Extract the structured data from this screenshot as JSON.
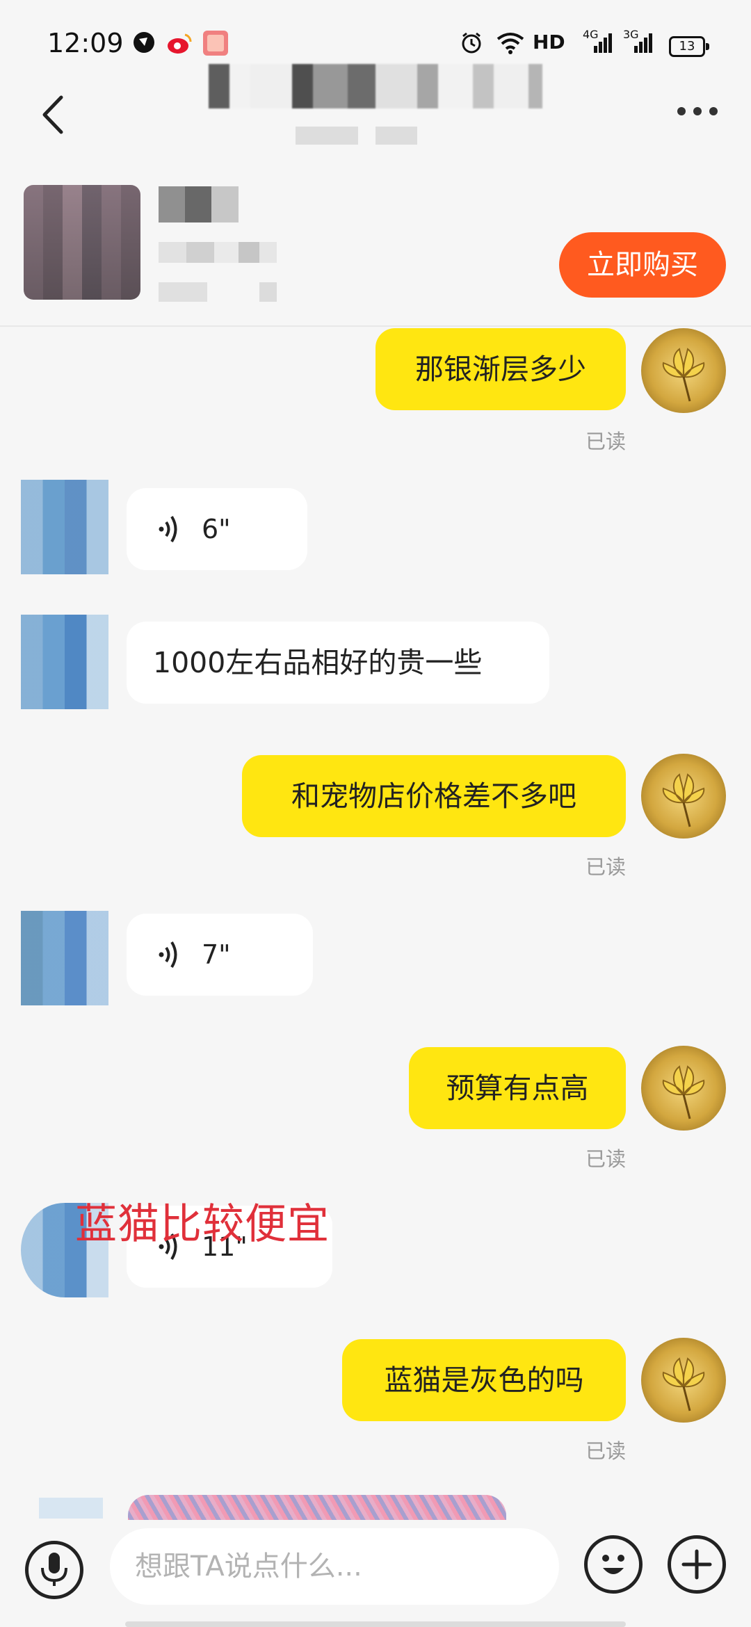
{
  "status_bar": {
    "time": "12:09",
    "network": "HD",
    "signal1": "4G",
    "signal2": "3G",
    "battery": "13"
  },
  "header": {
    "back_icon": "chevron-left-icon",
    "more_icon": "more-dots-icon"
  },
  "product": {
    "buy_label": "立即购买",
    "buy_color": "#ff5a1f"
  },
  "messages": [
    {
      "side": "me",
      "text": "那银渐层多少",
      "read": "已读"
    },
    {
      "side": "them",
      "type": "voice",
      "duration": "6\""
    },
    {
      "side": "them",
      "text": "1000左右品相好的贵一些"
    },
    {
      "side": "me",
      "text": "和宠物店价格差不多吧",
      "read": "已读"
    },
    {
      "side": "them",
      "type": "voice",
      "duration": "7\""
    },
    {
      "side": "me",
      "text": "预算有点高",
      "read": "已读"
    },
    {
      "side": "them",
      "type": "voice",
      "duration": "11\""
    },
    {
      "side": "me",
      "text": "蓝猫是灰色的吗",
      "read": "已读"
    }
  ],
  "overlay_text": "蓝猫比较便宜",
  "input": {
    "placeholder": "想跟TA说点什么..."
  },
  "colors": {
    "my_bubble": "#ffe611",
    "their_bubble": "#ffffff",
    "background": "#f6f6f6"
  }
}
